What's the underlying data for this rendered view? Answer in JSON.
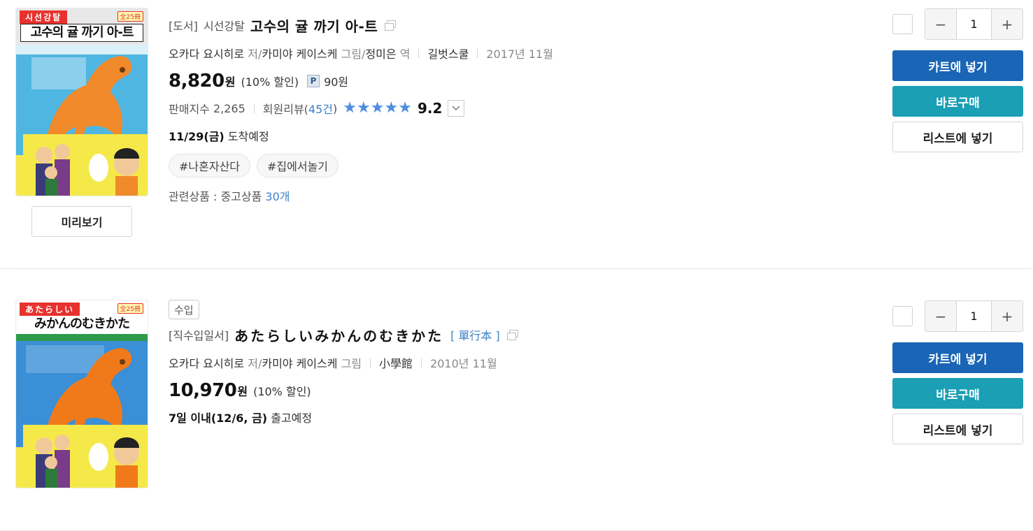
{
  "items": [
    {
      "cover": {
        "series": "시선강탈",
        "volume_tag": "全25冊",
        "title": "고수의 귤 까기 아-트",
        "colors": {
          "bg": "#4fb6e2",
          "horse": "#f08a2a",
          "top": "#e8e8e8",
          "bottom": "#f5e94a"
        }
      },
      "preview_label": "미리보기",
      "category": "[도서]",
      "prefix": "시선강탈",
      "title": "고수의 귤 까기 아-트",
      "volume": "",
      "meta": {
        "author": "오카다 요시히로",
        "author_role": "저/",
        "illustrator": "카미야 케이스케",
        "illustrator_role": "그림/",
        "translator": "정미은",
        "translator_role": "역",
        "publisher": "길벗스쿨",
        "date": "2017년 11월"
      },
      "price": "8,820",
      "won": "원",
      "discount": "(10% 할인)",
      "point_icon": "P",
      "point": "90원",
      "sales_label": "판매지수",
      "sales_value": "2,265",
      "review_label": "회원리뷰(",
      "review_count": "45건",
      "review_close": ")",
      "rating": "9.2",
      "delivery_date": "11/29(금)",
      "delivery_text": "도착예정",
      "tags": [
        "#나혼자산다",
        "#집에서놀기"
      ],
      "related_label": "관련상품 : 중고상품",
      "related_count": "30개",
      "qty": "1"
    },
    {
      "cover": {
        "series": "あたらしい",
        "volume_tag": "全25冊",
        "title": "みかんのむきかた",
        "colors": {
          "bg": "#3a8fd6",
          "horse": "#f07a1a",
          "top": "#ffffff",
          "bottom": "#f5e94a"
        }
      },
      "badge": "수입",
      "category": "[직수입일서]",
      "title": "あたらしいみかんのむきかた",
      "volume": "[ 單行本 ]",
      "meta": {
        "author": "오카다 요시히로",
        "author_role": "저/",
        "illustrator": "카미야 케이스케",
        "illustrator_role": "그림",
        "publisher": "小學館",
        "date": "2010년 11월"
      },
      "price": "10,970",
      "won": "원",
      "discount": "(10% 할인)",
      "delivery_date": "7일 이내(12/6, 금)",
      "delivery_text": "출고예정",
      "qty": "1"
    }
  ],
  "actions": {
    "minus": "−",
    "plus": "+",
    "cart_label": "카트에 넣기",
    "buy_label": "바로구매",
    "list_label": "리스트에 넣기"
  }
}
